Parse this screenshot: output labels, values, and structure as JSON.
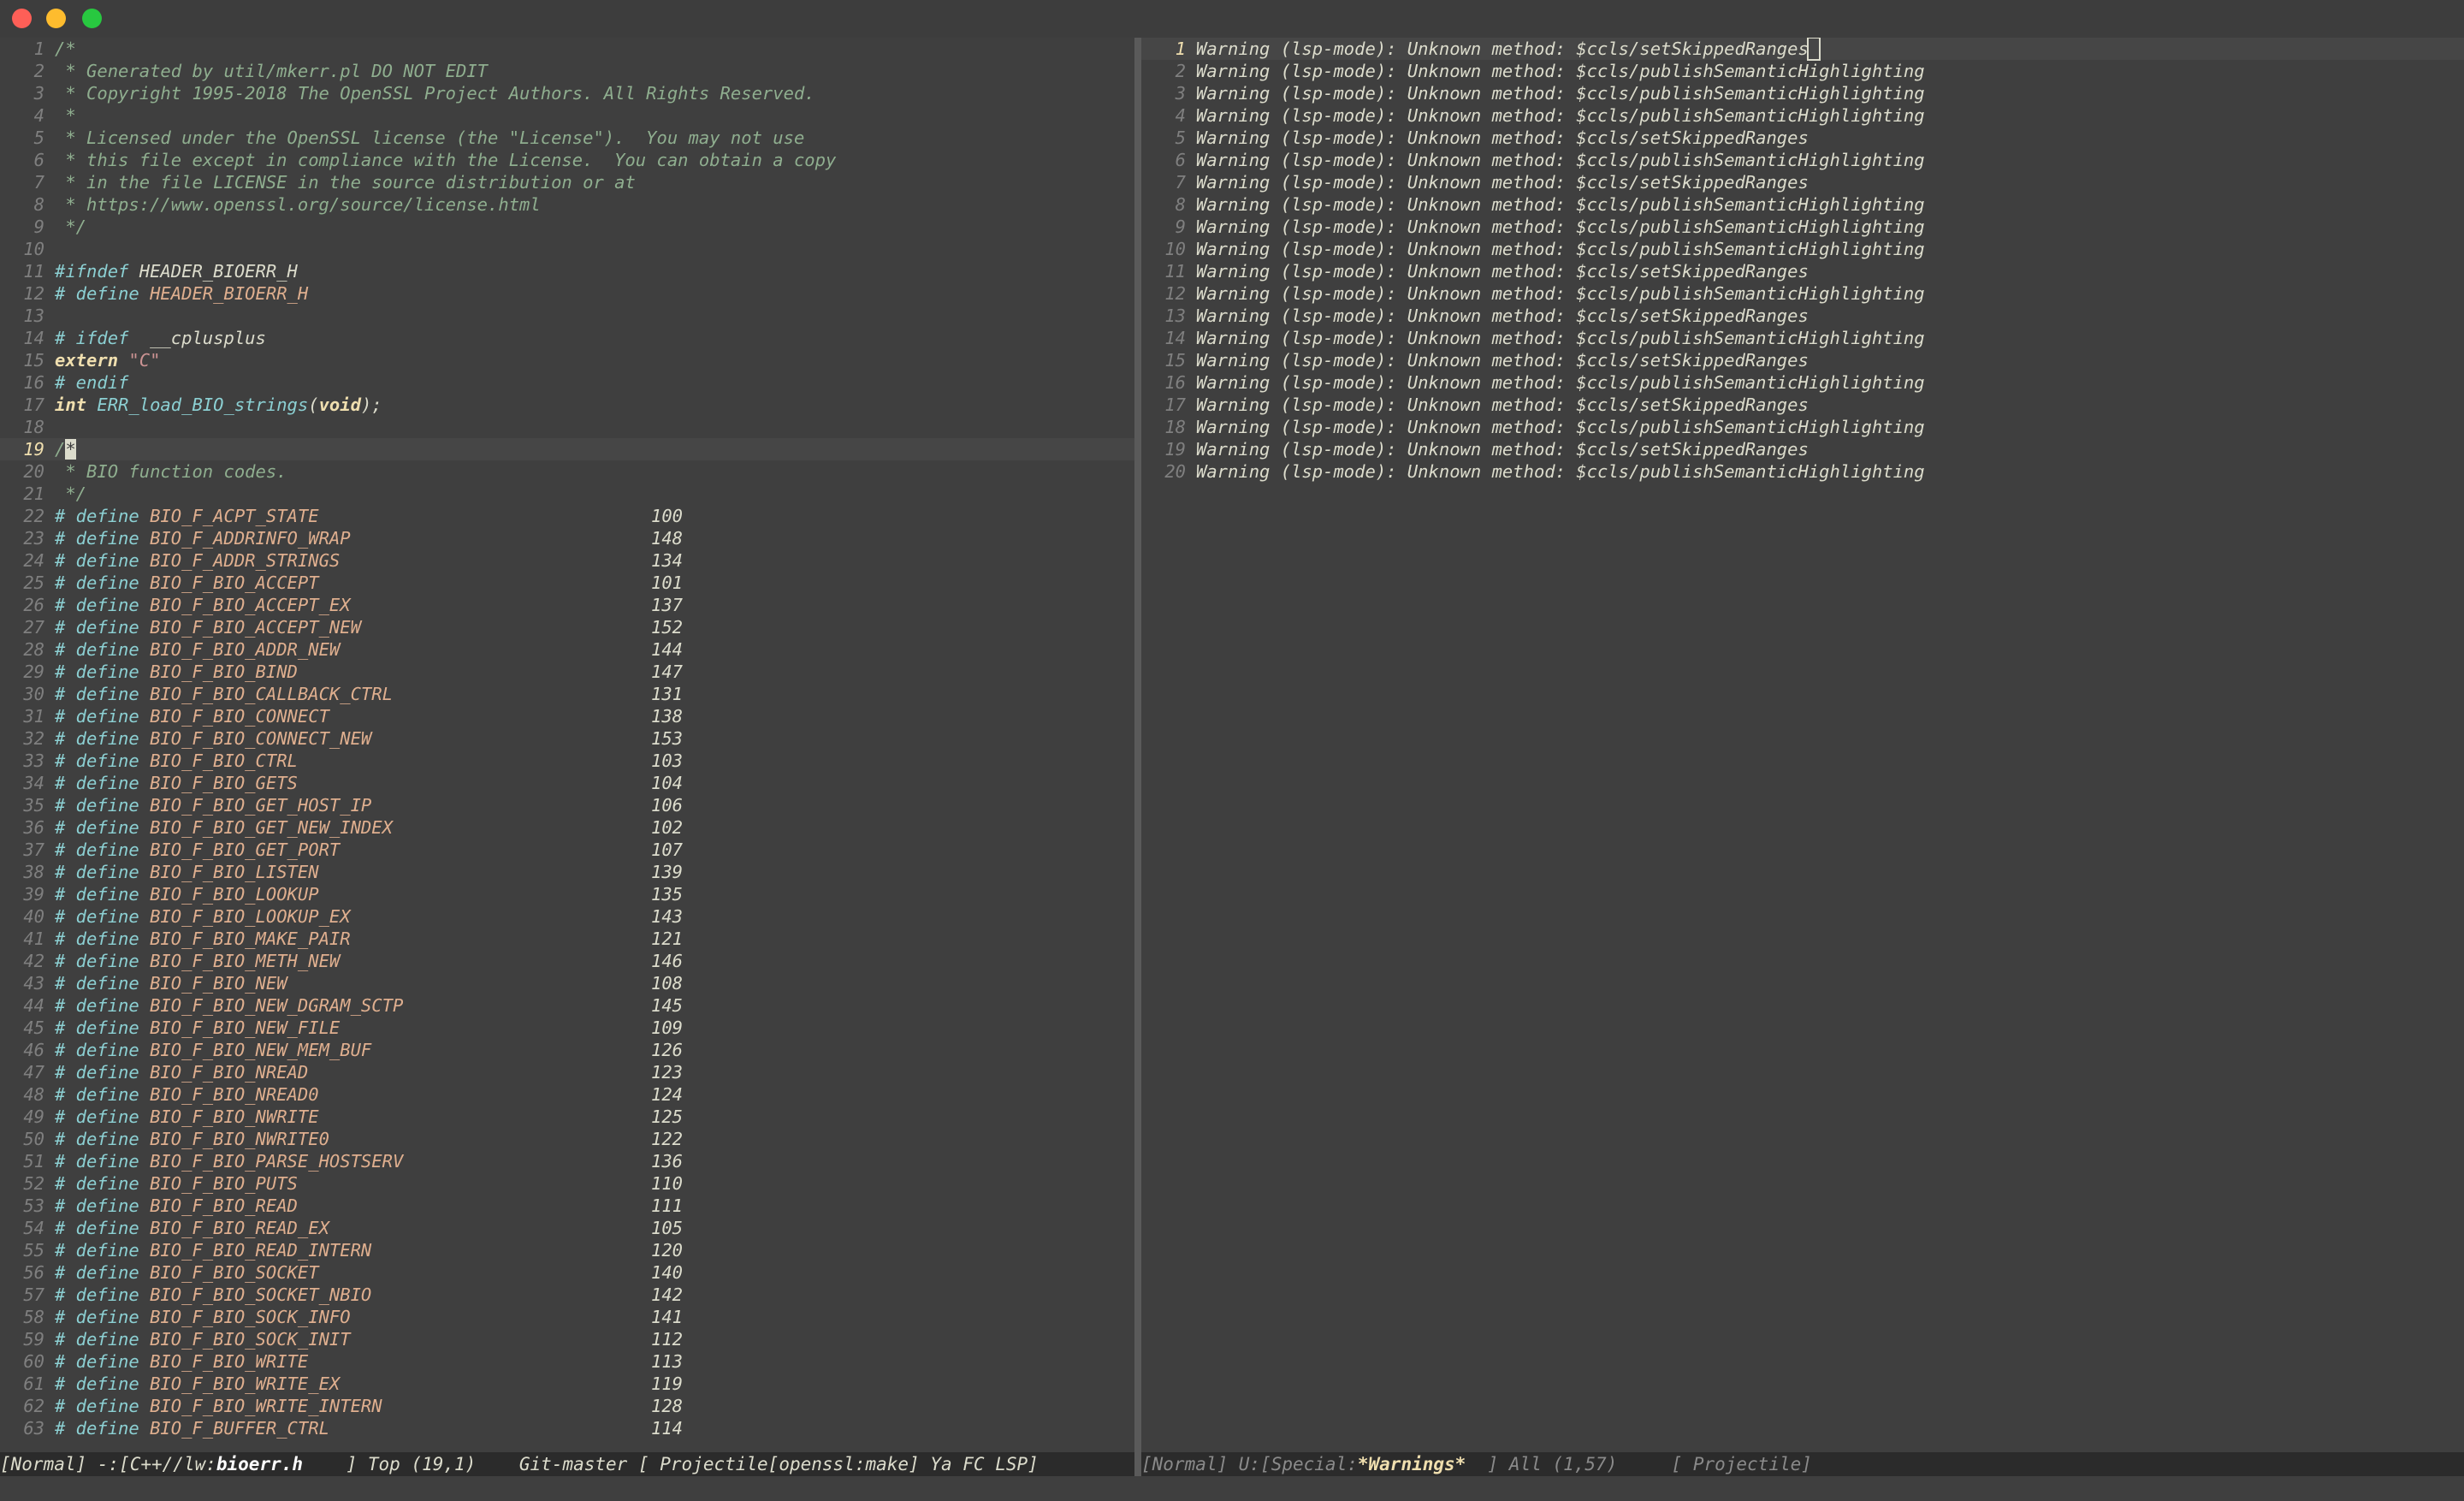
{
  "window": {
    "controls": [
      "close",
      "minimize",
      "maximize"
    ]
  },
  "colors": {
    "background": "#3f3f3f",
    "comment": "#8fae8f",
    "preprocessor": "#8cd0d3",
    "keyword": "#f0dfaf",
    "string": "#cc9393",
    "macro": "#dfaf8f",
    "modeline": "#2b2b2b"
  },
  "editor_left": {
    "current_line": 19,
    "lines": [
      {
        "n": "1",
        "segs": [
          [
            "comment",
            "/*"
          ]
        ]
      },
      {
        "n": "2",
        "segs": [
          [
            "comment",
            " * Generated by util/mkerr.pl DO NOT EDIT"
          ]
        ]
      },
      {
        "n": "3",
        "segs": [
          [
            "comment",
            " * Copyright 1995-2018 The OpenSSL Project Authors. All Rights Reserved."
          ]
        ]
      },
      {
        "n": "4",
        "segs": [
          [
            "comment",
            " *"
          ]
        ]
      },
      {
        "n": "5",
        "segs": [
          [
            "comment",
            " * Licensed under the OpenSSL license (the \"License\").  You may not use"
          ]
        ]
      },
      {
        "n": "6",
        "segs": [
          [
            "comment",
            " * this file except in compliance with the License.  You can obtain a copy"
          ]
        ]
      },
      {
        "n": "7",
        "segs": [
          [
            "comment",
            " * in the file LICENSE in the source distribution or at"
          ]
        ]
      },
      {
        "n": "8",
        "segs": [
          [
            "comment",
            " * https://www.openssl.org/source/license.html"
          ]
        ]
      },
      {
        "n": "9",
        "segs": [
          [
            "comment",
            " */"
          ]
        ]
      },
      {
        "n": "10",
        "segs": []
      },
      {
        "n": "11",
        "segs": [
          [
            "preproc",
            "#ifndef "
          ],
          [
            "plain",
            "HEADER_BIOERR_H"
          ]
        ]
      },
      {
        "n": "12",
        "segs": [
          [
            "preproc",
            "# define "
          ],
          [
            "macro",
            "HEADER_BIOERR_H"
          ]
        ]
      },
      {
        "n": "13",
        "segs": []
      },
      {
        "n": "14",
        "segs": [
          [
            "preproc",
            "# ifdef "
          ],
          [
            "plain",
            " __cplusplus"
          ]
        ]
      },
      {
        "n": "15",
        "segs": [
          [
            "kw",
            "extern "
          ],
          [
            "str",
            "\"C\""
          ]
        ]
      },
      {
        "n": "16",
        "segs": [
          [
            "preproc",
            "# endif"
          ]
        ]
      },
      {
        "n": "17",
        "segs": [
          [
            "kw",
            "int "
          ],
          [
            "func",
            "ERR_load_BIO_strings"
          ],
          [
            "plain",
            "("
          ],
          [
            "kw",
            "void"
          ],
          [
            "plain",
            ");"
          ]
        ]
      },
      {
        "n": "18",
        "segs": []
      },
      {
        "n": "19",
        "segs": [
          [
            "comment",
            "/"
          ],
          [
            "cursor",
            "*"
          ]
        ]
      },
      {
        "n": "20",
        "segs": [
          [
            "comment",
            " * BIO function codes."
          ]
        ]
      },
      {
        "n": "21",
        "segs": [
          [
            "comment",
            " */"
          ]
        ]
      },
      {
        "n": "22",
        "segs": [
          [
            "preproc",
            "# define "
          ],
          [
            "macro",
            "BIO_F_ACPT_STATE"
          ]
        ],
        "val": "100"
      },
      {
        "n": "23",
        "segs": [
          [
            "preproc",
            "# define "
          ],
          [
            "macro",
            "BIO_F_ADDRINFO_WRAP"
          ]
        ],
        "val": "148"
      },
      {
        "n": "24",
        "segs": [
          [
            "preproc",
            "# define "
          ],
          [
            "macro",
            "BIO_F_ADDR_STRINGS"
          ]
        ],
        "val": "134"
      },
      {
        "n": "25",
        "segs": [
          [
            "preproc",
            "# define "
          ],
          [
            "macro",
            "BIO_F_BIO_ACCEPT"
          ]
        ],
        "val": "101"
      },
      {
        "n": "26",
        "segs": [
          [
            "preproc",
            "# define "
          ],
          [
            "macro",
            "BIO_F_BIO_ACCEPT_EX"
          ]
        ],
        "val": "137"
      },
      {
        "n": "27",
        "segs": [
          [
            "preproc",
            "# define "
          ],
          [
            "macro",
            "BIO_F_BIO_ACCEPT_NEW"
          ]
        ],
        "val": "152"
      },
      {
        "n": "28",
        "segs": [
          [
            "preproc",
            "# define "
          ],
          [
            "macro",
            "BIO_F_BIO_ADDR_NEW"
          ]
        ],
        "val": "144"
      },
      {
        "n": "29",
        "segs": [
          [
            "preproc",
            "# define "
          ],
          [
            "macro",
            "BIO_F_BIO_BIND"
          ]
        ],
        "val": "147"
      },
      {
        "n": "30",
        "segs": [
          [
            "preproc",
            "# define "
          ],
          [
            "macro",
            "BIO_F_BIO_CALLBACK_CTRL"
          ]
        ],
        "val": "131"
      },
      {
        "n": "31",
        "segs": [
          [
            "preproc",
            "# define "
          ],
          [
            "macro",
            "BIO_F_BIO_CONNECT"
          ]
        ],
        "val": "138"
      },
      {
        "n": "32",
        "segs": [
          [
            "preproc",
            "# define "
          ],
          [
            "macro",
            "BIO_F_BIO_CONNECT_NEW"
          ]
        ],
        "val": "153"
      },
      {
        "n": "33",
        "segs": [
          [
            "preproc",
            "# define "
          ],
          [
            "macro",
            "BIO_F_BIO_CTRL"
          ]
        ],
        "val": "103"
      },
      {
        "n": "34",
        "segs": [
          [
            "preproc",
            "# define "
          ],
          [
            "macro",
            "BIO_F_BIO_GETS"
          ]
        ],
        "val": "104"
      },
      {
        "n": "35",
        "segs": [
          [
            "preproc",
            "# define "
          ],
          [
            "macro",
            "BIO_F_BIO_GET_HOST_IP"
          ]
        ],
        "val": "106"
      },
      {
        "n": "36",
        "segs": [
          [
            "preproc",
            "# define "
          ],
          [
            "macro",
            "BIO_F_BIO_GET_NEW_INDEX"
          ]
        ],
        "val": "102"
      },
      {
        "n": "37",
        "segs": [
          [
            "preproc",
            "# define "
          ],
          [
            "macro",
            "BIO_F_BIO_GET_PORT"
          ]
        ],
        "val": "107"
      },
      {
        "n": "38",
        "segs": [
          [
            "preproc",
            "# define "
          ],
          [
            "macro",
            "BIO_F_BIO_LISTEN"
          ]
        ],
        "val": "139"
      },
      {
        "n": "39",
        "segs": [
          [
            "preproc",
            "# define "
          ],
          [
            "macro",
            "BIO_F_BIO_LOOKUP"
          ]
        ],
        "val": "135"
      },
      {
        "n": "40",
        "segs": [
          [
            "preproc",
            "# define "
          ],
          [
            "macro",
            "BIO_F_BIO_LOOKUP_EX"
          ]
        ],
        "val": "143"
      },
      {
        "n": "41",
        "segs": [
          [
            "preproc",
            "# define "
          ],
          [
            "macro",
            "BIO_F_BIO_MAKE_PAIR"
          ]
        ],
        "val": "121"
      },
      {
        "n": "42",
        "segs": [
          [
            "preproc",
            "# define "
          ],
          [
            "macro",
            "BIO_F_BIO_METH_NEW"
          ]
        ],
        "val": "146"
      },
      {
        "n": "43",
        "segs": [
          [
            "preproc",
            "# define "
          ],
          [
            "macro",
            "BIO_F_BIO_NEW"
          ]
        ],
        "val": "108"
      },
      {
        "n": "44",
        "segs": [
          [
            "preproc",
            "# define "
          ],
          [
            "macro",
            "BIO_F_BIO_NEW_DGRAM_SCTP"
          ]
        ],
        "val": "145"
      },
      {
        "n": "45",
        "segs": [
          [
            "preproc",
            "# define "
          ],
          [
            "macro",
            "BIO_F_BIO_NEW_FILE"
          ]
        ],
        "val": "109"
      },
      {
        "n": "46",
        "segs": [
          [
            "preproc",
            "# define "
          ],
          [
            "macro",
            "BIO_F_BIO_NEW_MEM_BUF"
          ]
        ],
        "val": "126"
      },
      {
        "n": "47",
        "segs": [
          [
            "preproc",
            "# define "
          ],
          [
            "macro",
            "BIO_F_BIO_NREAD"
          ]
        ],
        "val": "123"
      },
      {
        "n": "48",
        "segs": [
          [
            "preproc",
            "# define "
          ],
          [
            "macro",
            "BIO_F_BIO_NREAD0"
          ]
        ],
        "val": "124"
      },
      {
        "n": "49",
        "segs": [
          [
            "preproc",
            "# define "
          ],
          [
            "macro",
            "BIO_F_BIO_NWRITE"
          ]
        ],
        "val": "125"
      },
      {
        "n": "50",
        "segs": [
          [
            "preproc",
            "# define "
          ],
          [
            "macro",
            "BIO_F_BIO_NWRITE0"
          ]
        ],
        "val": "122"
      },
      {
        "n": "51",
        "segs": [
          [
            "preproc",
            "# define "
          ],
          [
            "macro",
            "BIO_F_BIO_PARSE_HOSTSERV"
          ]
        ],
        "val": "136"
      },
      {
        "n": "52",
        "segs": [
          [
            "preproc",
            "# define "
          ],
          [
            "macro",
            "BIO_F_BIO_PUTS"
          ]
        ],
        "val": "110"
      },
      {
        "n": "53",
        "segs": [
          [
            "preproc",
            "# define "
          ],
          [
            "macro",
            "BIO_F_BIO_READ"
          ]
        ],
        "val": "111"
      },
      {
        "n": "54",
        "segs": [
          [
            "preproc",
            "# define "
          ],
          [
            "macro",
            "BIO_F_BIO_READ_EX"
          ]
        ],
        "val": "105"
      },
      {
        "n": "55",
        "segs": [
          [
            "preproc",
            "# define "
          ],
          [
            "macro",
            "BIO_F_BIO_READ_INTERN"
          ]
        ],
        "val": "120"
      },
      {
        "n": "56",
        "segs": [
          [
            "preproc",
            "# define "
          ],
          [
            "macro",
            "BIO_F_BIO_SOCKET"
          ]
        ],
        "val": "140"
      },
      {
        "n": "57",
        "segs": [
          [
            "preproc",
            "# define "
          ],
          [
            "macro",
            "BIO_F_BIO_SOCKET_NBIO"
          ]
        ],
        "val": "142"
      },
      {
        "n": "58",
        "segs": [
          [
            "preproc",
            "# define "
          ],
          [
            "macro",
            "BIO_F_BIO_SOCK_INFO"
          ]
        ],
        "val": "141"
      },
      {
        "n": "59",
        "segs": [
          [
            "preproc",
            "# define "
          ],
          [
            "macro",
            "BIO_F_BIO_SOCK_INIT"
          ]
        ],
        "val": "112"
      },
      {
        "n": "60",
        "segs": [
          [
            "preproc",
            "# define "
          ],
          [
            "macro",
            "BIO_F_BIO_WRITE"
          ]
        ],
        "val": "113"
      },
      {
        "n": "61",
        "segs": [
          [
            "preproc",
            "# define "
          ],
          [
            "macro",
            "BIO_F_BIO_WRITE_EX"
          ]
        ],
        "val": "119"
      },
      {
        "n": "62",
        "segs": [
          [
            "preproc",
            "# define "
          ],
          [
            "macro",
            "BIO_F_BIO_WRITE_INTERN"
          ]
        ],
        "val": "128"
      },
      {
        "n": "63",
        "segs": [
          [
            "preproc",
            "# define "
          ],
          [
            "macro",
            "BIO_F_BUFFER_CTRL"
          ]
        ],
        "val": "114"
      }
    ]
  },
  "editor_right": {
    "current_line": 1,
    "lines": [
      {
        "n": "1",
        "text": "Warning (lsp-mode): Unknown method: $ccls/setSkippedRanges"
      },
      {
        "n": "2",
        "text": "Warning (lsp-mode): Unknown method: $ccls/publishSemanticHighlighting"
      },
      {
        "n": "3",
        "text": "Warning (lsp-mode): Unknown method: $ccls/publishSemanticHighlighting"
      },
      {
        "n": "4",
        "text": "Warning (lsp-mode): Unknown method: $ccls/publishSemanticHighlighting"
      },
      {
        "n": "5",
        "text": "Warning (lsp-mode): Unknown method: $ccls/setSkippedRanges"
      },
      {
        "n": "6",
        "text": "Warning (lsp-mode): Unknown method: $ccls/publishSemanticHighlighting"
      },
      {
        "n": "7",
        "text": "Warning (lsp-mode): Unknown method: $ccls/setSkippedRanges"
      },
      {
        "n": "8",
        "text": "Warning (lsp-mode): Unknown method: $ccls/publishSemanticHighlighting"
      },
      {
        "n": "9",
        "text": "Warning (lsp-mode): Unknown method: $ccls/publishSemanticHighlighting"
      },
      {
        "n": "10",
        "text": "Warning (lsp-mode): Unknown method: $ccls/publishSemanticHighlighting"
      },
      {
        "n": "11",
        "text": "Warning (lsp-mode): Unknown method: $ccls/setSkippedRanges"
      },
      {
        "n": "12",
        "text": "Warning (lsp-mode): Unknown method: $ccls/publishSemanticHighlighting"
      },
      {
        "n": "13",
        "text": "Warning (lsp-mode): Unknown method: $ccls/setSkippedRanges"
      },
      {
        "n": "14",
        "text": "Warning (lsp-mode): Unknown method: $ccls/publishSemanticHighlighting"
      },
      {
        "n": "15",
        "text": "Warning (lsp-mode): Unknown method: $ccls/setSkippedRanges"
      },
      {
        "n": "16",
        "text": "Warning (lsp-mode): Unknown method: $ccls/publishSemanticHighlighting"
      },
      {
        "n": "17",
        "text": "Warning (lsp-mode): Unknown method: $ccls/setSkippedRanges"
      },
      {
        "n": "18",
        "text": "Warning (lsp-mode): Unknown method: $ccls/publishSemanticHighlighting"
      },
      {
        "n": "19",
        "text": "Warning (lsp-mode): Unknown method: $ccls/setSkippedRanges"
      },
      {
        "n": "20",
        "text": "Warning (lsp-mode): Unknown method: $ccls/publishSemanticHighlighting"
      }
    ]
  },
  "modeline_left": {
    "prefix": "[Normal] -:[C++//lw:",
    "buffer": "bioerr.h",
    "suffix": "    ] Top (19,1)    Git-master [ Projectile[openssl:make] Ya FC LSP]"
  },
  "modeline_right": {
    "prefix": "[Normal] U:[Special:",
    "buffer": "*Warnings*",
    "suffix": "  ] All (1,57)     [ Projectile]"
  }
}
